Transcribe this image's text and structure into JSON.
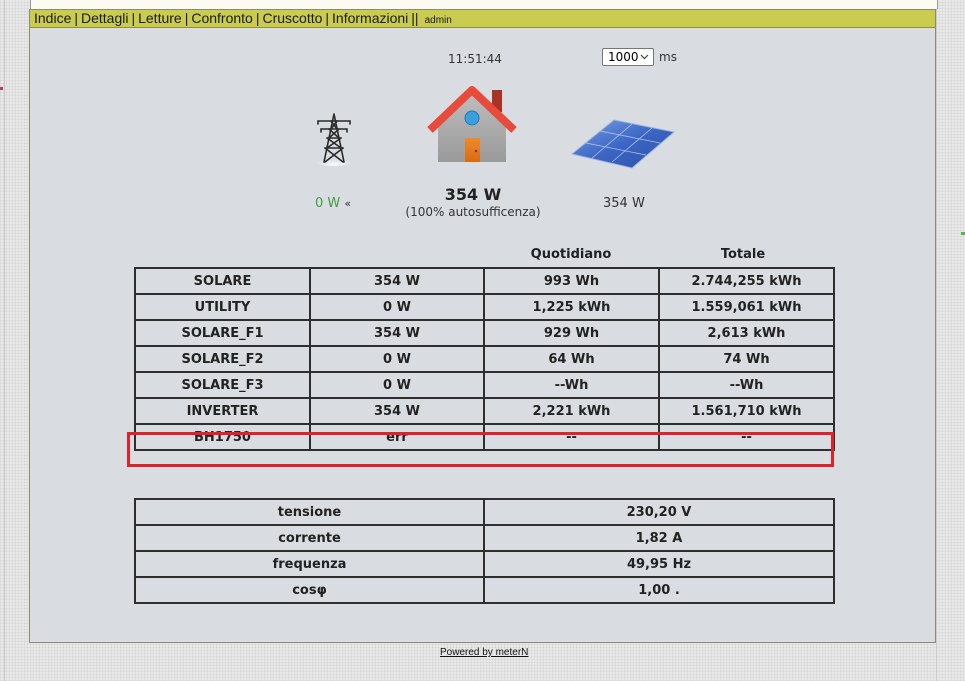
{
  "nav": {
    "items": [
      "Indice",
      "Dettagli",
      "Letture",
      "Confronto",
      "Cruscotto",
      "Informazioni"
    ],
    "separator": "|",
    "double_separator": "||",
    "user": "admin"
  },
  "clock": "11:51:44",
  "refresh": {
    "value": "1000",
    "unit": "ms"
  },
  "icons": {
    "grid": "power-pylon-icon",
    "house": "house-icon",
    "solar": "solar-panel-icon"
  },
  "grid_power": "0 W",
  "house_power": "354 W",
  "self_sufficiency": "(100% autosufficenza)",
  "solar_power": "354 W",
  "meters": {
    "columns": [
      "Quotidiano",
      "Totale"
    ],
    "rows": [
      {
        "name": "SOLARE",
        "power": "354 W",
        "daily": "993 Wh",
        "total": "2.744,255 kWh"
      },
      {
        "name": "UTILITY",
        "power": "0 W",
        "daily": "1,225 kWh",
        "total": "1.559,061 kWh"
      },
      {
        "name": "SOLARE_F1",
        "power": "354 W",
        "daily": "929 Wh",
        "total": "2,613 kWh"
      },
      {
        "name": "SOLARE_F2",
        "power": "0 W",
        "daily": "64 Wh",
        "total": "74 Wh"
      },
      {
        "name": "SOLARE_F3",
        "power": "0 W",
        "daily": "--Wh",
        "total": "--Wh"
      },
      {
        "name": "INVERTER",
        "power": "354 W",
        "daily": "2,221 kWh",
        "total": "1.561,710 kWh"
      },
      {
        "name": "BH1750",
        "power": "err",
        "daily": "--",
        "total": "--"
      }
    ]
  },
  "electrical": [
    {
      "label": "tensione",
      "value": "230,20 V"
    },
    {
      "label": "corrente",
      "value": "1,82 A"
    },
    {
      "label": "frequenza",
      "value": "49,95 Hz"
    },
    {
      "label": "cosφ",
      "value": "1,00 ."
    }
  ],
  "footer": "Powered by meterN",
  "colors": {
    "nav_bg": "#c9cc4e",
    "content_bg": "#d9dce1",
    "highlight": "#e0202a",
    "grid_value": "#3f9f3f"
  }
}
